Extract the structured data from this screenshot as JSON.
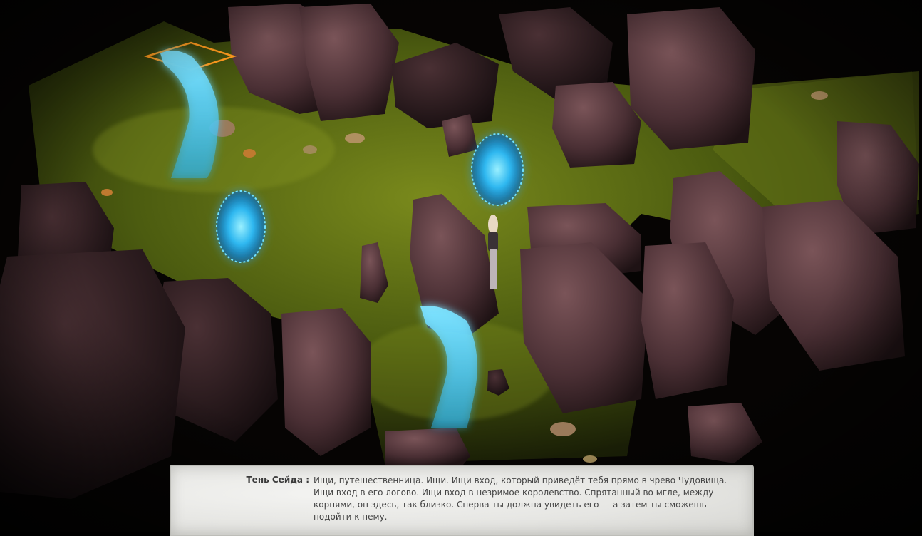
{
  "dialog": {
    "speaker": "Тень Сейда :",
    "text": "Ищи, путешественница. Ищи. Ищи вход, который приведёт тебя прямо в чрево Чудовища. Ищи вход в его логово. Ищи вход в незримое королевство. Спрятанный во мгле, между корнями, он здесь, так близко. Сперва ты должна увидеть его — а затем ты сможешь подойти к нему."
  },
  "colors": {
    "moss": "#5a6a12",
    "rock": "#4a2f34",
    "portal": "#29c8ff",
    "marker": "#ff9a1e"
  }
}
